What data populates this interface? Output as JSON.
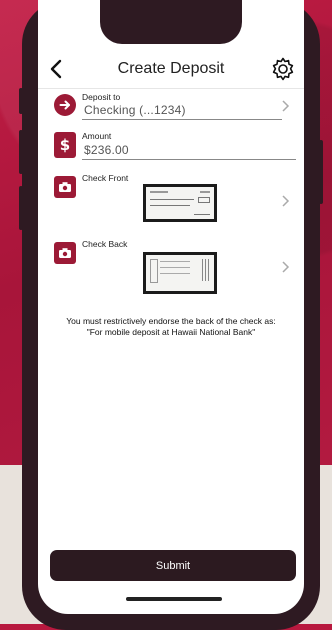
{
  "header": {
    "title": "Create Deposit",
    "back_icon": "chevron-left-icon",
    "settings_icon": "gear-icon"
  },
  "deposit_to": {
    "label": "Deposit to",
    "value": "Checking (...1234)",
    "icon": "arrow-right-circle-icon"
  },
  "amount": {
    "label": "Amount",
    "value": "$236.00",
    "icon": "dollar-receipt-icon"
  },
  "check_front": {
    "label": "Check Front",
    "icon": "camera-icon"
  },
  "check_back": {
    "label": "Check Back",
    "icon": "camera-icon"
  },
  "notice": "You must restrictively endorse the back of the check as: \"For mobile deposit at Hawaii National Bank\"",
  "submit_label": "Submit",
  "colors": {
    "accent": "#9c1a36",
    "button": "#2c1a20",
    "background": "#b8193f"
  }
}
